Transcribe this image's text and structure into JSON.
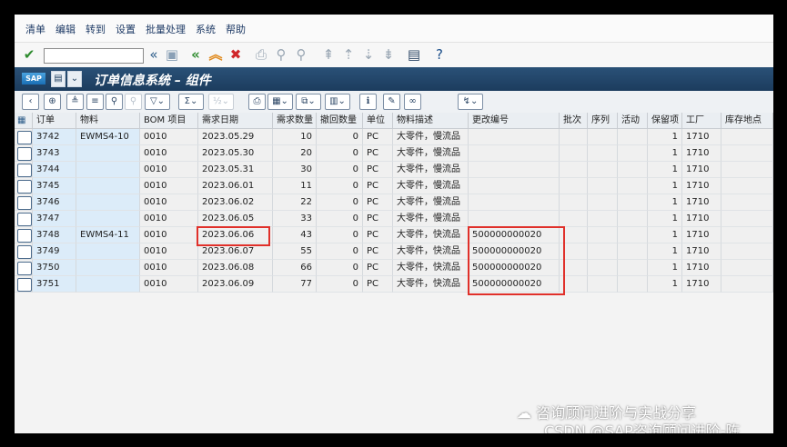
{
  "menu": [
    "清单",
    "编辑",
    "转到",
    "设置",
    "批量处理",
    "系统",
    "帮助"
  ],
  "title": "订单信息系统 – 组件",
  "sap_logo": "SAP",
  "columns": [
    "订单",
    "物料",
    "BOM 项目",
    "需求日期",
    "需求数量",
    "撤回数量",
    "单位",
    "物料描述",
    "更改编号",
    "批次",
    "序列",
    "活动",
    "保留项",
    "工厂",
    "库存地点"
  ],
  "rows": [
    {
      "order": "3742",
      "material": "EWMS4-10",
      "bom": "0010",
      "date": "2023.05.29",
      "req": "10",
      "wd": "0",
      "unit": "PC",
      "desc": "大零件，慢流品",
      "change": "",
      "res": "1",
      "plant": "1710"
    },
    {
      "order": "3743",
      "material": "",
      "bom": "0010",
      "date": "2023.05.30",
      "req": "20",
      "wd": "0",
      "unit": "PC",
      "desc": "大零件，慢流品",
      "change": "",
      "res": "1",
      "plant": "1710"
    },
    {
      "order": "3744",
      "material": "",
      "bom": "0010",
      "date": "2023.05.31",
      "req": "30",
      "wd": "0",
      "unit": "PC",
      "desc": "大零件，慢流品",
      "change": "",
      "res": "1",
      "plant": "1710"
    },
    {
      "order": "3745",
      "material": "",
      "bom": "0010",
      "date": "2023.06.01",
      "req": "11",
      "wd": "0",
      "unit": "PC",
      "desc": "大零件，慢流品",
      "change": "",
      "res": "1",
      "plant": "1710"
    },
    {
      "order": "3746",
      "material": "",
      "bom": "0010",
      "date": "2023.06.02",
      "req": "22",
      "wd": "0",
      "unit": "PC",
      "desc": "大零件，慢流品",
      "change": "",
      "res": "1",
      "plant": "1710"
    },
    {
      "order": "3747",
      "material": "",
      "bom": "0010",
      "date": "2023.06.05",
      "req": "33",
      "wd": "0",
      "unit": "PC",
      "desc": "大零件，慢流品",
      "change": "",
      "res": "1",
      "plant": "1710"
    },
    {
      "order": "3748",
      "material": "EWMS4-11",
      "bom": "0010",
      "date": "2023.06.06",
      "req": "43",
      "wd": "0",
      "unit": "PC",
      "desc": "大零件，快流品",
      "change": "500000000020",
      "res": "1",
      "plant": "1710"
    },
    {
      "order": "3749",
      "material": "",
      "bom": "0010",
      "date": "2023.06.07",
      "req": "55",
      "wd": "0",
      "unit": "PC",
      "desc": "大零件，快流品",
      "change": "500000000020",
      "res": "1",
      "plant": "1710"
    },
    {
      "order": "3750",
      "material": "",
      "bom": "0010",
      "date": "2023.06.08",
      "req": "66",
      "wd": "0",
      "unit": "PC",
      "desc": "大零件，快流品",
      "change": "500000000020",
      "res": "1",
      "plant": "1710"
    },
    {
      "order": "3751",
      "material": "",
      "bom": "0010",
      "date": "2023.06.09",
      "req": "77",
      "wd": "0",
      "unit": "PC",
      "desc": "大零件，快流品",
      "change": "500000000020",
      "res": "1",
      "plant": "1710"
    }
  ],
  "watermark1": "咨询顾问进阶与实战分享",
  "watermark2": "CSDN @SAP咨询顾问进阶-陈",
  "icons": {
    "toolbar1": [
      "check-icon",
      "command-field",
      "back-double-icon",
      "save-icon",
      "back-icon",
      "up-icon",
      "cancel-icon",
      "print-icon",
      "find-icon",
      "find-next-icon",
      "first-page-icon",
      "previous-page-icon",
      "next-page-icon",
      "last-page-icon",
      "new-window-icon",
      "help-icon"
    ],
    "toolbar2": [
      "back-arrow-icon",
      "details-icon",
      "sort-ascending-icon",
      "sort-descending-icon",
      "search-icon",
      "search-next-icon",
      "filter-icon",
      "sum-icon",
      "subtotal-icon",
      "print-preview-icon",
      "export-icon",
      "spreadsheet-icon",
      "layout-icon",
      "info-icon",
      "edit-icon",
      "glasses-icon",
      "workflow-icon"
    ]
  },
  "colors": {
    "title_bar": "#1c3c5e",
    "key_column": "#dcecf9",
    "highlight": "#e0302a"
  }
}
